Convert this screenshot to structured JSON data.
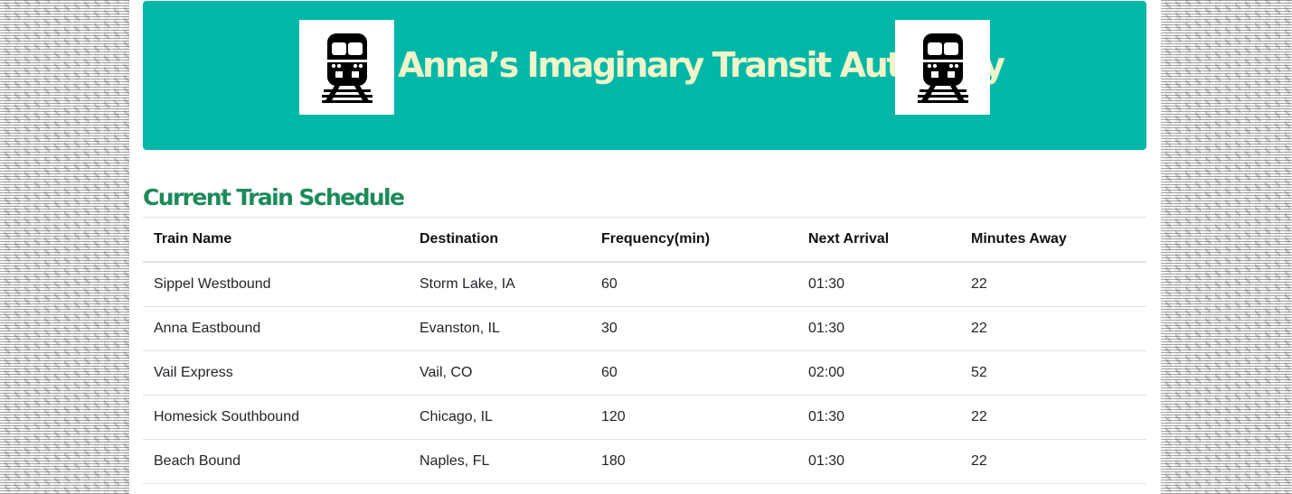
{
  "header": {
    "title": "Anna’s Imaginary Transit Authority",
    "background_color": "#00b7a8",
    "title_color": "#f0f5c9",
    "logo_icon": "train-icon"
  },
  "schedule": {
    "heading": "Current Train Schedule",
    "heading_color": "#1c8a5a",
    "columns": [
      "Train Name",
      "Destination",
      "Frequency(min)",
      "Next Arrival",
      "Minutes Away"
    ],
    "rows": [
      [
        "Sippel Westbound",
        "Storm Lake, IA",
        "60",
        "01:30",
        "22"
      ],
      [
        "Anna Eastbound",
        "Evanston, IL",
        "30",
        "01:30",
        "22"
      ],
      [
        "Vail Express",
        "Vail, CO",
        "60",
        "02:00",
        "52"
      ],
      [
        "Homesick Southbound",
        "Chicago, IL",
        "120",
        "01:30",
        "22"
      ],
      [
        "Beach Bound",
        "Naples, FL",
        "180",
        "01:30",
        "22"
      ]
    ]
  }
}
